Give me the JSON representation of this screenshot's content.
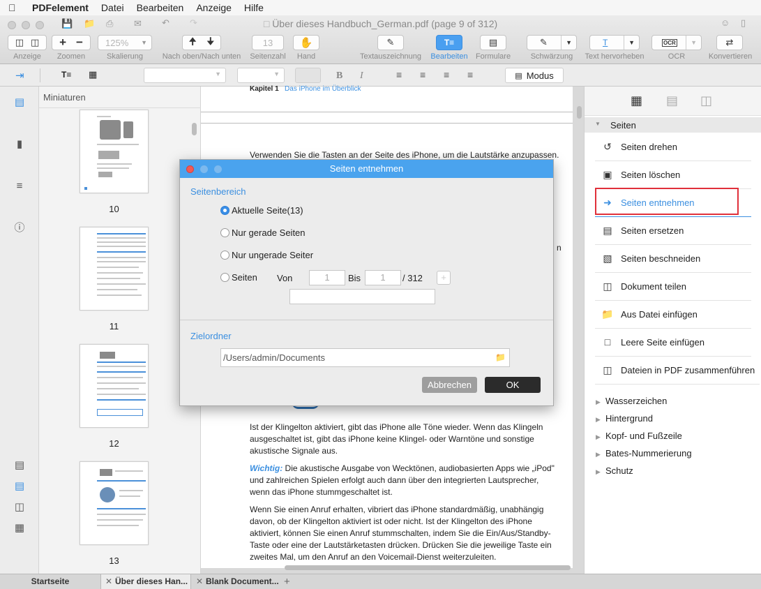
{
  "menubar": {
    "app": "PDFelement",
    "items": [
      "Datei",
      "Bearbeiten",
      "Anzeige",
      "Hilfe"
    ]
  },
  "window": {
    "title": "Über dieses Handbuch_German.pdf (page 9 of 312)"
  },
  "toolbar": {
    "zoom_value": "125%",
    "page_number": "13",
    "labels": {
      "view": "Anzeige",
      "zoom": "Zoomen",
      "scale": "Skalierung",
      "nav": "Nach oben/Nach unten",
      "page": "Seitenzahl",
      "hand": "Hand",
      "markup": "Textauszeichnung",
      "edit": "Bearbeiten",
      "forms": "Formulare",
      "redact": "Schwärzung",
      "highlight": "Text hervorheben",
      "ocr": "OCR",
      "convert": "Konvertieren"
    }
  },
  "fmtbar": {
    "mode_label": "Modus",
    "bold": "B",
    "italic": "I"
  },
  "thumbnails": {
    "header": "Miniaturen",
    "pages": [
      "10",
      "11",
      "12",
      "13"
    ]
  },
  "document": {
    "chapter": "Kapitel 1",
    "chapter_title": "Das iPhone im Überblick",
    "line1": "Verwenden Sie die Tasten an der Seite des iPhone, um die Lautstärke anzupassen.",
    "para1": "Ist der Klingelton aktiviert, gibt das iPhone alle Töne wieder. Wenn das Klingeln ausgeschaltet ist, gibt das iPhone keine Klingel- oder Warntöne und sonstige akustische Signale aus.",
    "important_label": "Wichtig:",
    "para2": " Die akustische Ausgabe von Wecktönen, audiobasierten Apps wie „iPod\" und zahlreichen Spielen erfolgt auch dann über den integrierten Lautsprecher, wenn das iPhone stummgeschaltet ist.",
    "para3": "Wenn Sie einen Anruf erhalten, vibriert das iPhone standardmäßig, unabhängig davon, ob der Klingelton aktiviert ist oder nicht. Ist der Klingelton des iPhone aktiviert, können Sie einen Anruf stummschalten, indem Sie die Ein/Aus/Standby-Taste oder eine der Lautstärketasten drücken. Drücken Sie die jeweilige Taste ein zweites Mal, um den Anruf an den Voicemail-Dienst weiterzuleiten."
  },
  "right_panel": {
    "section": "Seiten",
    "items": [
      "Seiten drehen",
      "Seiten löschen",
      "Seiten entnehmen",
      "Seiten ersetzen",
      "Seiten beschneiden",
      "Dokument teilen",
      "Aus Datei einfügen",
      "Leere Seite einfügen",
      "Dateien in PDF zusammenführen"
    ],
    "collapsed": [
      "Wasserzeichen",
      "Hintergrund",
      "Kopf- und Fußzeile",
      "Bates-Nummerierung",
      "Schutz"
    ],
    "highlight_color": "#e0303a"
  },
  "dialog": {
    "title": "Seiten entnehmen",
    "range_label": "Seitenbereich",
    "options": [
      "Aktuelle Seite(13)",
      "Nur gerade Seiten",
      "Nur ungerade Seiter",
      "Seiten"
    ],
    "selected_option": "Aktuelle Seite(13)",
    "from_label": "Von",
    "from_value": "1",
    "to_label": "Bis",
    "to_value": "1",
    "total": "/ 312",
    "folder_label": "Zielordner",
    "folder_path": "/Users/admin/Documents",
    "cancel": "Abbrechen",
    "ok": "OK"
  },
  "tabs": [
    "Startseite",
    "Über dieses Han...",
    "Blank Document..."
  ],
  "colors": {
    "accent": "#4aa3ee",
    "ok_button": "#2b2b2b"
  }
}
